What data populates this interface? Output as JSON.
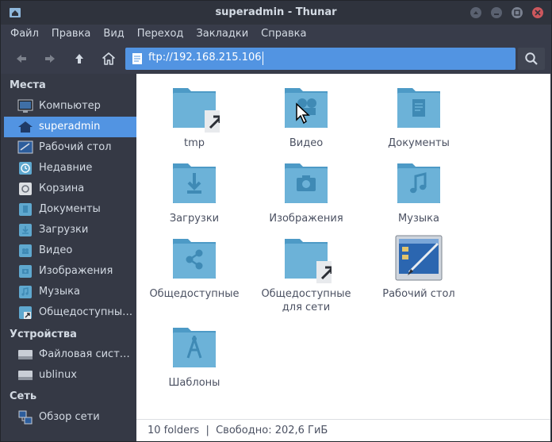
{
  "window": {
    "title": "superadmin - Thunar"
  },
  "menu": {
    "items": [
      "Файл",
      "Правка",
      "Вид",
      "Переход",
      "Закладки",
      "Справка"
    ]
  },
  "location": {
    "path": "ftp://192.168.215.106"
  },
  "sidebar": {
    "places_header": "Места",
    "places": [
      {
        "label": "Компьютер",
        "icon": "computer-icon"
      },
      {
        "label": "superadmin",
        "icon": "home-icon",
        "active": true
      },
      {
        "label": "Рабочий стол",
        "icon": "desktop-icon"
      },
      {
        "label": "Недавние",
        "icon": "recent-icon"
      },
      {
        "label": "Корзина",
        "icon": "trash-icon"
      },
      {
        "label": "Документы",
        "icon": "documents-icon"
      },
      {
        "label": "Загрузки",
        "icon": "downloads-icon"
      },
      {
        "label": "Видео",
        "icon": "video-icon"
      },
      {
        "label": "Изображения",
        "icon": "pictures-icon"
      },
      {
        "label": "Музыка",
        "icon": "music-icon"
      },
      {
        "label": "Общедоступные сети",
        "icon": "network-share-icon"
      }
    ],
    "devices_header": "Устройства",
    "devices": [
      {
        "label": "Файловая система",
        "icon": "drive-icon"
      },
      {
        "label": "ublinux",
        "icon": "drive-icon"
      }
    ],
    "network_header": "Сеть",
    "network": [
      {
        "label": "Обзор сети",
        "icon": "network-icon"
      }
    ]
  },
  "files": [
    {
      "label": "tmp",
      "icon": "folder-symlink-icon"
    },
    {
      "label": "Видео",
      "icon": "folder-video-icon"
    },
    {
      "label": "Документы",
      "icon": "folder-documents-icon"
    },
    {
      "label": "Загрузки",
      "icon": "folder-downloads-icon"
    },
    {
      "label": "Изображения",
      "icon": "folder-pictures-icon"
    },
    {
      "label": "Музыка",
      "icon": "folder-music-icon"
    },
    {
      "label": "Общедоступные",
      "icon": "folder-publicshare-icon"
    },
    {
      "label": "Общедоступные для сети",
      "icon": "folder-symlink-icon"
    },
    {
      "label": "Рабочий стол",
      "icon": "desktop-app-icon"
    },
    {
      "label": "Шаблоны",
      "icon": "folder-templates-icon"
    }
  ],
  "status": {
    "text": "10 folders  |  Свободно: 202,6 ГиБ"
  },
  "colors": {
    "accent": "#5294e2",
    "folder": "#5fa8cf",
    "folder_dark": "#3f8ab5"
  }
}
